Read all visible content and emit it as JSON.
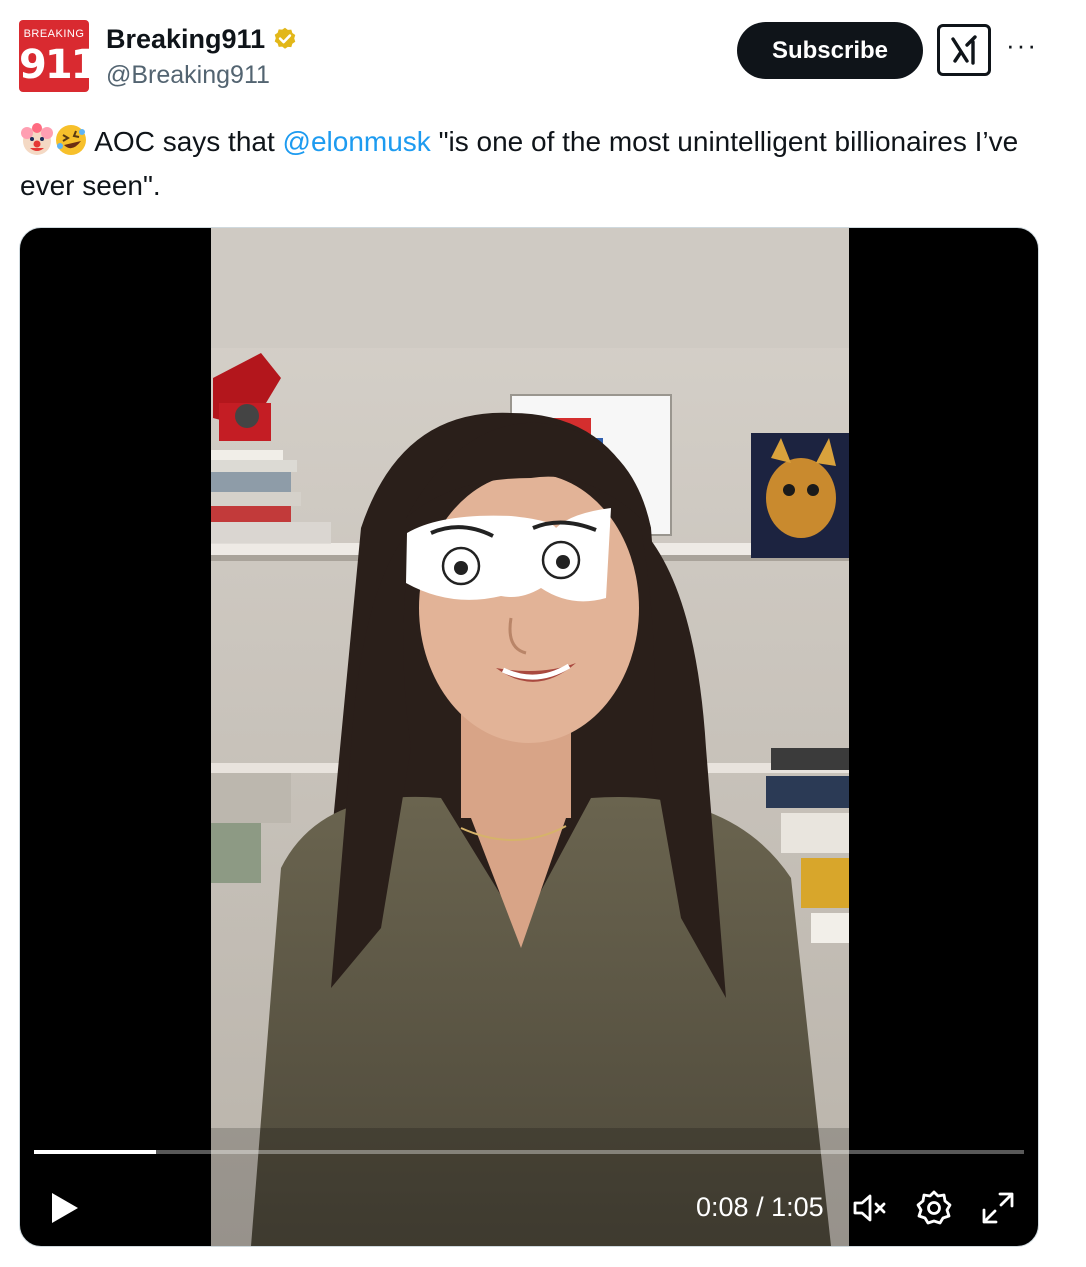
{
  "author": {
    "avatar_text_top": "BREAKING",
    "avatar_text_number": "911",
    "display_name": "Breaking911",
    "handle": "@Breaking911",
    "verified_icon": "gold-verified-badge-icon"
  },
  "actions": {
    "subscribe_label": "Subscribe",
    "grok_icon": "grok-icon",
    "more_label": "···"
  },
  "tweet": {
    "emoji_1": "clown-face-emoji",
    "emoji_2": "rolling-on-floor-laughing-emoji",
    "text_before": " AOC says that ",
    "mention": "@elonmusk",
    "text_after": " \"is one of the most unintelligent billionaires I’ve ever seen\"."
  },
  "video": {
    "current_time": "0:08",
    "separator": " / ",
    "duration": "1:05",
    "progress_fraction": 0.123,
    "play_icon": "play-icon",
    "mute_icon": "muted-speaker-icon",
    "settings_icon": "gear-icon",
    "fullscreen_icon": "fullscreen-icon"
  },
  "colors": {
    "brand_red": "#d92a30",
    "link_blue": "#1d9bf0",
    "verified_gold": "#e2b719",
    "text_dark": "#0f1419",
    "text_muted": "#536471"
  }
}
